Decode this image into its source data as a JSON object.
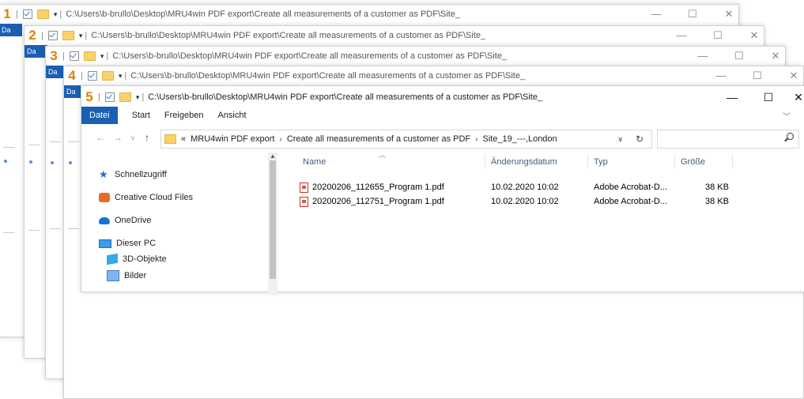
{
  "window_path": "C:\\Users\\b-brullo\\Desktop\\MRU4win PDF export\\Create all measurements of a customer as PDF\\Site_",
  "stack_numbers": [
    "1",
    "2",
    "3",
    "4",
    "5"
  ],
  "ghost_tab_label": "Da",
  "window_controls": {
    "minimize": "—",
    "maximize": "☐",
    "close": "✕"
  },
  "ribbon": {
    "file": "Datei",
    "tabs": [
      "Start",
      "Freigeben",
      "Ansicht"
    ]
  },
  "address": {
    "prefix": "«",
    "segments": [
      "MRU4win PDF export",
      "Create all measurements of a customer as PDF",
      "Site_19_---,London"
    ],
    "separator": "›"
  },
  "search": {
    "placeholder": ""
  },
  "nav_items": [
    {
      "label": "Schnellzugriff",
      "icon": "star-icon"
    },
    {
      "label": "Creative Cloud Files",
      "icon": "creative-cloud-icon"
    },
    {
      "label": "OneDrive",
      "icon": "onedrive-cloud-icon"
    },
    {
      "label": "Dieser PC",
      "icon": "computer-icon"
    },
    {
      "label": "3D-Objekte",
      "icon": "3d-objects-icon"
    },
    {
      "label": "Bilder",
      "icon": "pictures-icon"
    }
  ],
  "columns": [
    "Name",
    "Änderungsdatum",
    "Typ",
    "Größe"
  ],
  "files": [
    {
      "name": "20200206_112655_Program 1.pdf",
      "date": "10.02.2020 10:02",
      "type": "Adobe Acrobat-D...",
      "size": "38 KB"
    },
    {
      "name": "20200206_112751_Program 1.pdf",
      "date": "10.02.2020 10:02",
      "type": "Adobe Acrobat-D...",
      "size": "38 KB"
    }
  ],
  "colors": {
    "accent": "#1a5fb4",
    "number": "#e08000"
  }
}
